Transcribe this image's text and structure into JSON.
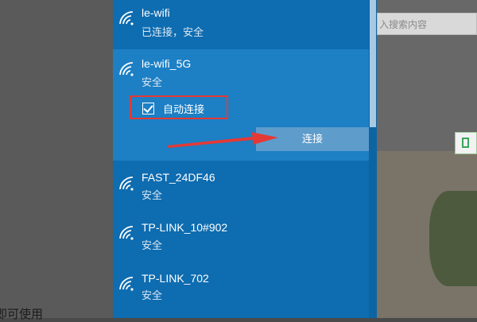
{
  "background": {
    "search_placeholder": "入搜索内容",
    "left_text": "即可使用"
  },
  "networks": [
    {
      "name": "le-wifi",
      "status": "已连接，安全",
      "icon": "wifi-icon"
    },
    {
      "name": "le-wifi_5G",
      "status": "安全",
      "icon": "wifi-icon",
      "selected": true,
      "auto_connect_label": "自动连接",
      "auto_connect_checked": true,
      "connect_label": "连接"
    },
    {
      "name": "FAST_24DF46",
      "status": "安全",
      "icon": "wifi-icon"
    },
    {
      "name": "TP-LINK_10#902",
      "status": "安全",
      "icon": "wifi-icon"
    },
    {
      "name": "TP-LINK_702",
      "status": "安全",
      "icon": "wifi-icon"
    }
  ],
  "colors": {
    "flyout_bg": "#0e6cb0",
    "selected_bg": "#1d7fc4",
    "connect_button": "#5e9ccb",
    "annotation_red": "#e53935"
  }
}
